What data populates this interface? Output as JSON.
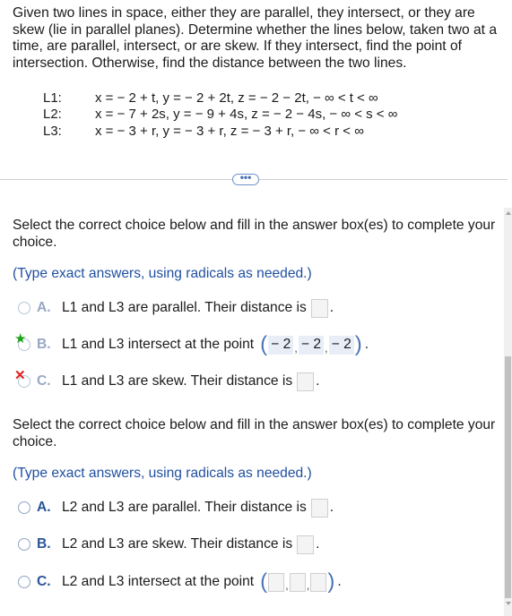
{
  "intro": "Given two lines in space, either they are parallel, they intersect, or they are skew (lie in parallel planes). Determine whether the lines below, taken two at a time, are parallel, intersect, or are skew. If they intersect, find the point of intersection. Otherwise, find the distance between the two lines.",
  "lines": [
    {
      "label": "L1:",
      "eq": "x = − 2 + t, y = − 2 + 2t, z = − 2 − 2t,  − ∞ < t < ∞"
    },
    {
      "label": "L2:",
      "eq": "x = − 7 + 2s, y = − 9 + 4s, z = − 2 − 4s,  − ∞ < s < ∞"
    },
    {
      "label": "L3:",
      "eq": "x = − 3 + r, y = − 3 + r, z = − 3 + r,  − ∞ < r < ∞"
    }
  ],
  "more_button": "•••",
  "q1": {
    "prompt": "Select the correct choice below and fill in the answer box(es) to complete your choice.",
    "hint": "(Type exact answers, using radicals as needed.)",
    "a": {
      "letter": "A.",
      "text": "L1 and L3 are parallel. Their distance is"
    },
    "b": {
      "letter": "B.",
      "text": "L1 and L3 intersect at the point",
      "coords": [
        "− 2",
        "− 2",
        "− 2"
      ]
    },
    "c": {
      "letter": "C.",
      "text": "L1 and L3 are skew. Their distance is"
    }
  },
  "q2": {
    "prompt": "Select the correct choice below and fill in the answer box(es) to complete your choice.",
    "hint": "(Type exact answers, using radicals as needed.)",
    "a": {
      "letter": "A.",
      "text": "L2 and L3 are parallel. Their distance is"
    },
    "b": {
      "letter": "B.",
      "text": "L2 and L3 are skew. Their distance is"
    },
    "c": {
      "letter": "C.",
      "text": "L2 and L3 intersect at the point"
    }
  },
  "punct": {
    "period": ".",
    "open_paren": "(",
    "close_paren": ")",
    "comma": ","
  },
  "icons": {
    "star": "★",
    "x": "✕"
  },
  "colors": {
    "accent": "#2a5596",
    "hint": "#1f4fa0",
    "correct": "#19a319",
    "wrong": "#e02020"
  }
}
